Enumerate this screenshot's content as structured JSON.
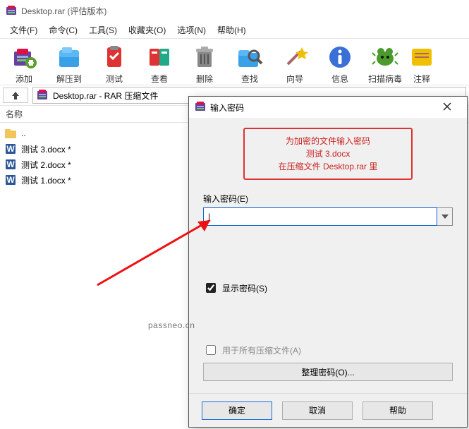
{
  "window": {
    "title": "Desktop.rar (评估版本)"
  },
  "menu": {
    "file": "文件(F)",
    "commands": "命令(C)",
    "tools": "工具(S)",
    "favorites": "收藏夹(O)",
    "options": "选项(N)",
    "help": "帮助(H)"
  },
  "toolbar": {
    "add": "添加",
    "extract": "解压到",
    "test": "测试",
    "view": "查看",
    "delete": "删除",
    "find": "查找",
    "wizard": "向导",
    "info": "信息",
    "virus": "扫描病毒",
    "comment": "注释"
  },
  "address": {
    "path": "Desktop.rar - RAR 压缩文件"
  },
  "list": {
    "header_name": "名称",
    "rows": [
      {
        "icon": "folder-up",
        "text": ".."
      },
      {
        "icon": "docx",
        "text": "测试 3.docx *"
      },
      {
        "icon": "docx",
        "text": "测试 2.docx *"
      },
      {
        "icon": "docx",
        "text": "测试 1.docx *"
      }
    ]
  },
  "dialog": {
    "title": "输入密码",
    "msg_line1": "为加密的文件输入密码",
    "msg_line2": "测试 3.docx",
    "msg_line3": "在压缩文件 Desktop.rar 里",
    "input_label": "输入密码(E)",
    "input_value": "|",
    "show_pw": "显示密码(S)",
    "apply_all": "用于所有压缩文件(A)",
    "organize": "整理密码(O)...",
    "ok": "确定",
    "cancel": "取消",
    "help": "帮助"
  },
  "watermark": "passneo.cn"
}
